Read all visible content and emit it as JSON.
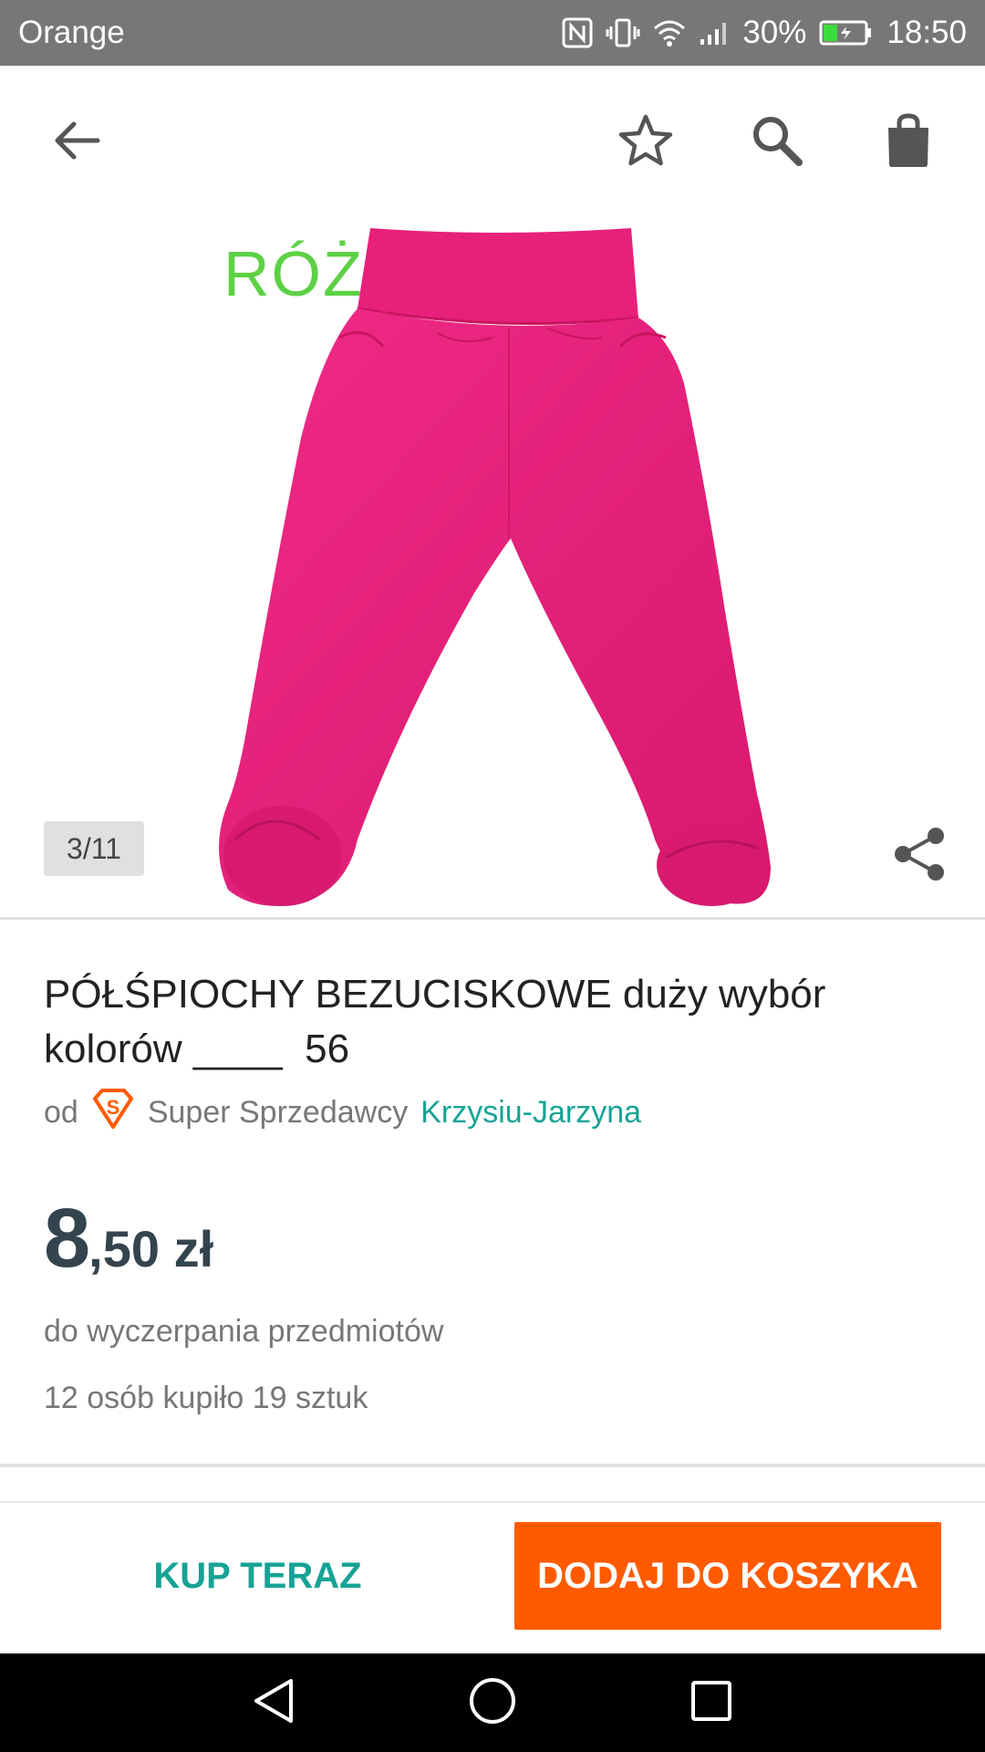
{
  "status_bar": {
    "carrier": "Orange",
    "battery_percent": "30%",
    "time": "18:50"
  },
  "toolbar": {
    "back_icon": "arrow-left-icon",
    "favorite_icon": "star-icon",
    "search_icon": "search-icon",
    "cart_icon": "shopping-bag-icon"
  },
  "gallery": {
    "image_label": "RÓŻ",
    "counter": "3/11",
    "share_icon": "share-icon",
    "product_color": "#e8217a"
  },
  "product": {
    "title": "PÓŁŚPIOCHY BEZUCISKOWE duży wybór\nkolorów ____  56",
    "seller_prefix": "od",
    "seller_badge_icon": "super-seller-badge-icon",
    "seller_type": "Super Sprzedawcy",
    "seller_name": "Krzysiu-Jarzyna",
    "price_main": "8",
    "price_rest": ",50 zł",
    "availability": "do wyczerpania przedmiotów",
    "sold_info": "12 osób kupiło 19 sztuk"
  },
  "actions": {
    "buy_now_label": "KUP TERAZ",
    "add_to_cart_label": "DODAJ DO KOSZYKA"
  },
  "colors": {
    "accent_teal": "#16a395",
    "accent_orange": "#ff5a00",
    "price_dark": "#33444e"
  }
}
